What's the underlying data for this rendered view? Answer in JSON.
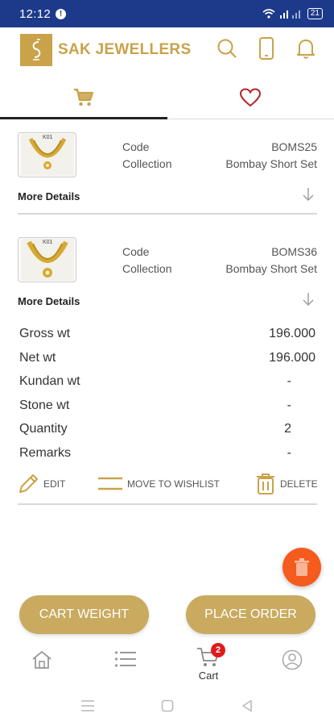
{
  "status": {
    "time": "12:12",
    "notif": "!",
    "battery": "21"
  },
  "header": {
    "brand": "SAK JEWELLERS"
  },
  "tabs": [
    {
      "icon": "cart-icon",
      "active": true
    },
    {
      "icon": "heart-icon",
      "active": false
    }
  ],
  "items": [
    {
      "code_label": "Code",
      "code": "BOMS25",
      "collection_label": "Collection",
      "collection": "Bombay Short Set",
      "more": "More Details",
      "tag": "K01"
    },
    {
      "code_label": "Code",
      "code": "BOMS36",
      "collection_label": "Collection",
      "collection": "Bombay Short Set",
      "more": "More Details",
      "tag": "K01",
      "details": [
        {
          "label": "Gross wt",
          "value": "196.000"
        },
        {
          "label": "Net wt",
          "value": "196.000"
        },
        {
          "label": "Kundan wt",
          "value": "-"
        },
        {
          "label": "Stone wt",
          "value": "-"
        },
        {
          "label": "Quantity",
          "value": "2"
        },
        {
          "label": "Remarks",
          "value": "-"
        }
      ],
      "actions": {
        "edit": "EDIT",
        "wishlist": "MOVE TO WISHLIST",
        "delete": "DELETE"
      }
    }
  ],
  "buttons": {
    "cart_weight": "CART WEIGHT",
    "place_order": "PLACE ORDER"
  },
  "bottom_nav": {
    "cart_label": "Cart",
    "cart_badge": "2"
  },
  "colors": {
    "gold": "#c9a24a",
    "statusbar": "#1d3a8a",
    "fab": "#f45b1d",
    "badge": "#e01b1b"
  }
}
